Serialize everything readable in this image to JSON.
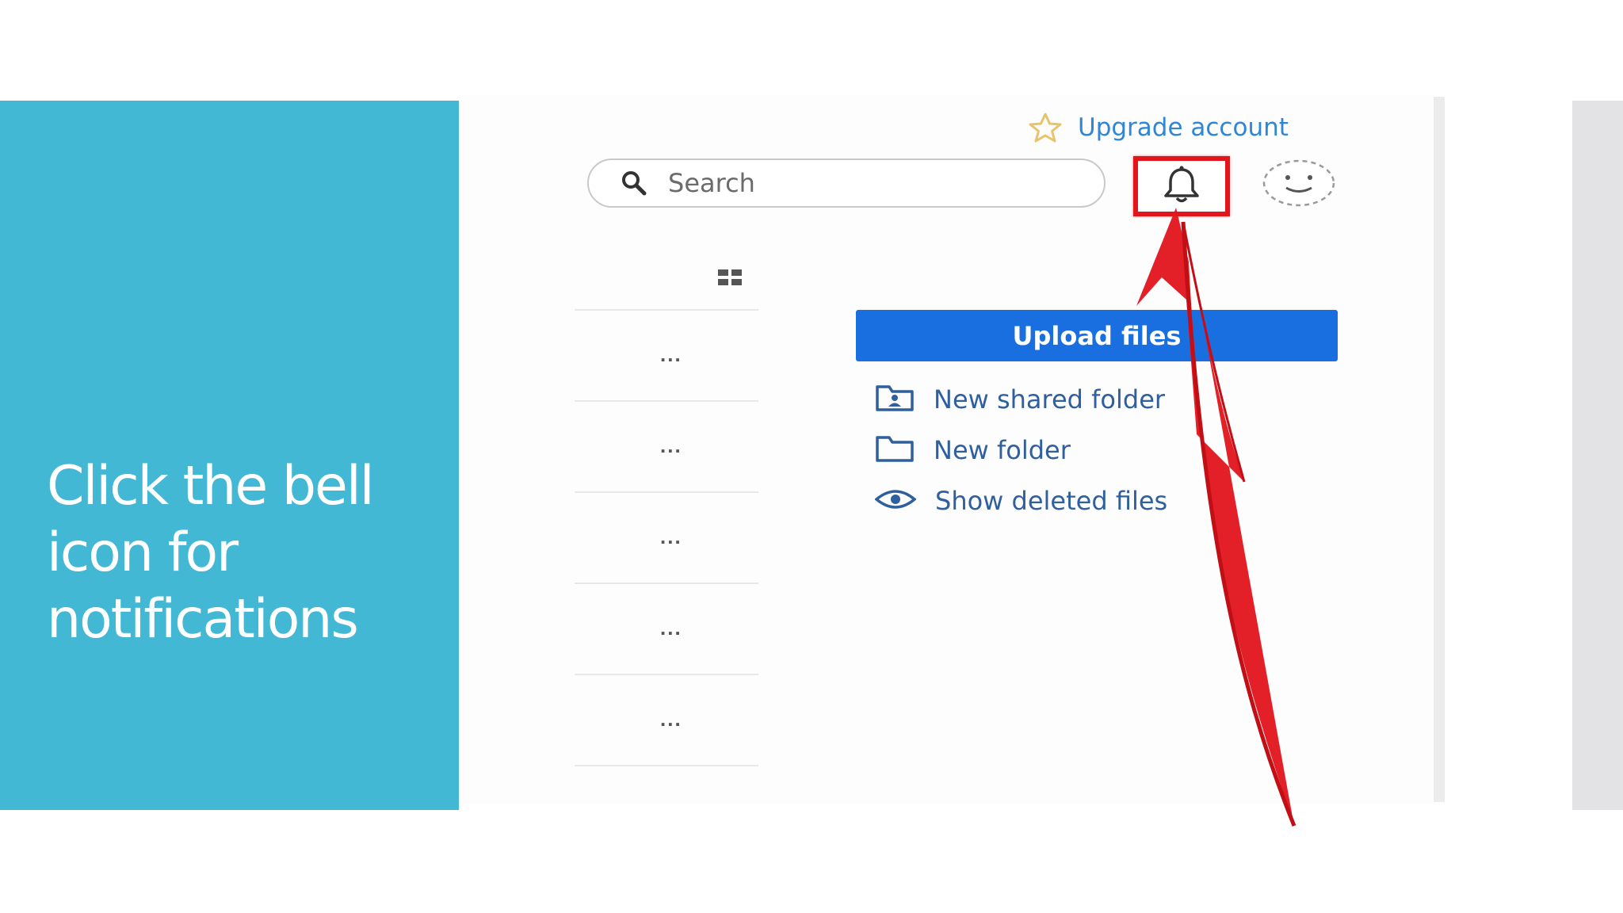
{
  "slide": {
    "instruction": "Click the bell icon for notifications"
  },
  "header": {
    "upgrade_label": "Upgrade account",
    "search_placeholder": "Search"
  },
  "file_list": {
    "row_menu_label": "...",
    "rows": [
      {
        "menu": "..."
      },
      {
        "menu": "..."
      },
      {
        "menu": "..."
      },
      {
        "menu": "..."
      },
      {
        "menu": "..."
      }
    ]
  },
  "actions": {
    "upload_label": "Upload files",
    "new_shared_folder": "New shared folder",
    "new_folder": "New folder",
    "show_deleted": "Show deleted files"
  },
  "colors": {
    "slide_panel": "#42b8d4",
    "highlight": "#e2141c",
    "primary_button": "#1a6fe0",
    "link": "#2f86d4"
  },
  "icons": [
    "star-icon",
    "search-icon",
    "bell-icon",
    "avatar-icon",
    "grid-view-icon",
    "shared-folder-icon",
    "folder-icon",
    "eye-icon"
  ]
}
